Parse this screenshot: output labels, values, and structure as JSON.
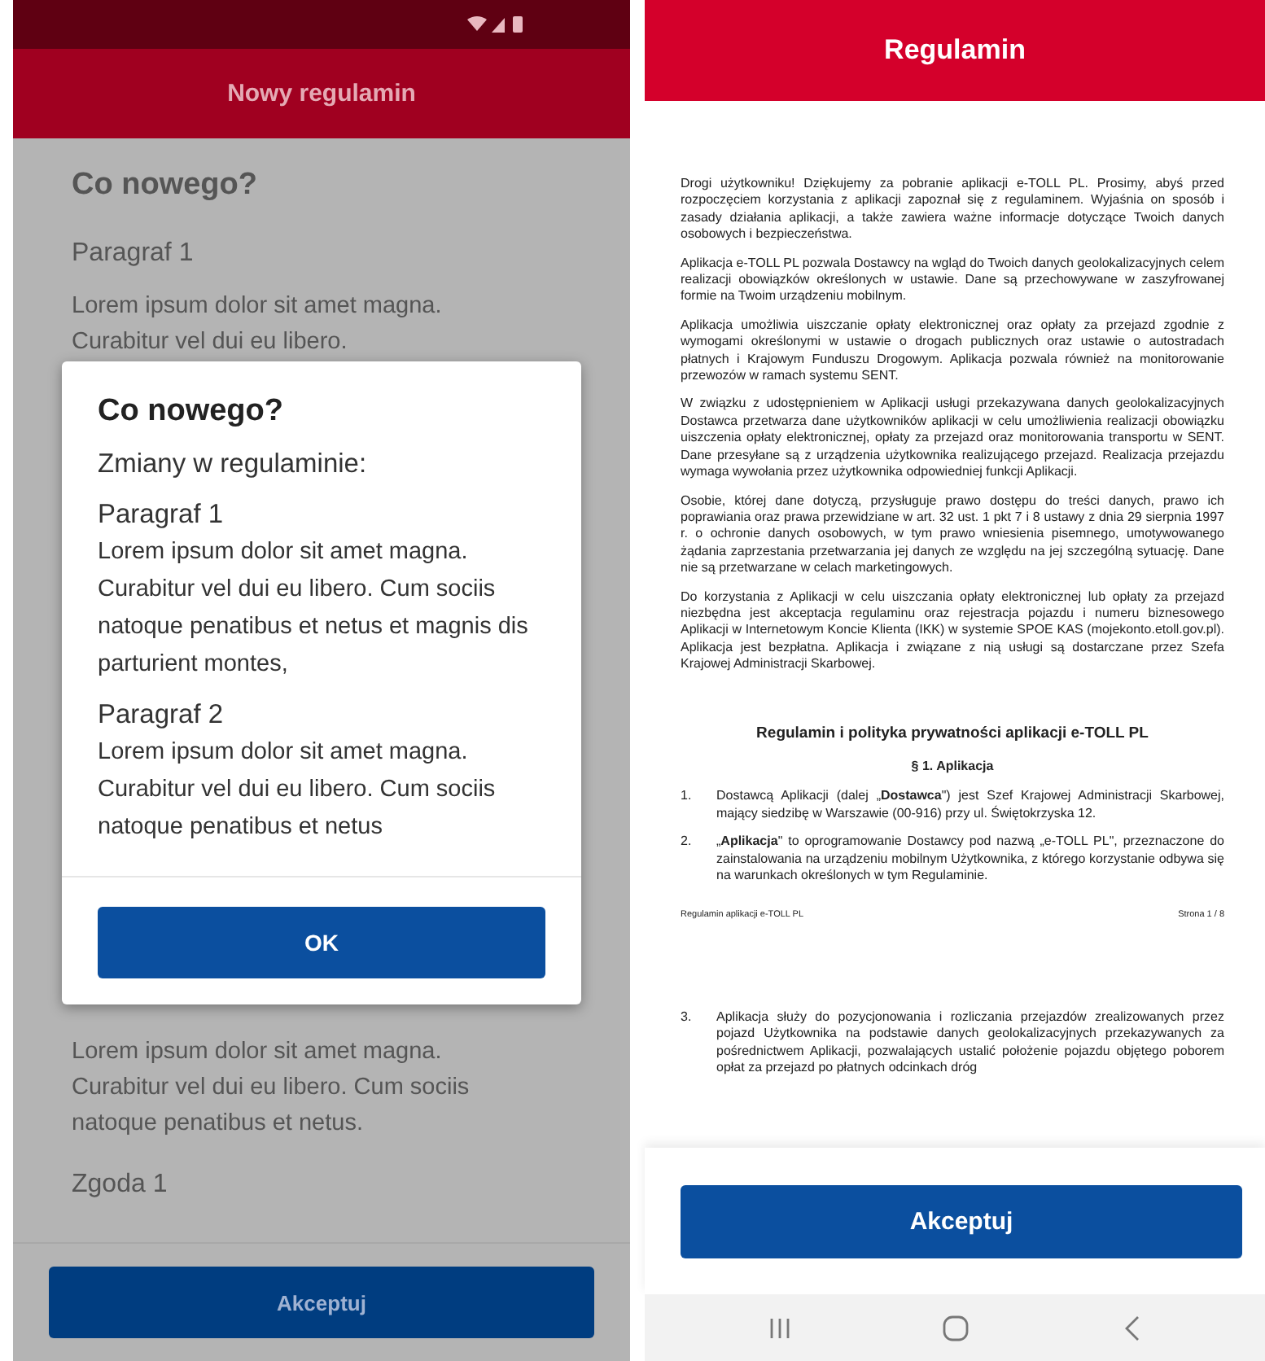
{
  "left_screen": {
    "header": {
      "title": "Nowy regulamin"
    },
    "background_top": [
      {
        "kind": "heading",
        "text": "Co nowego?"
      },
      {
        "kind": "subheading",
        "text": "Paragraf 1"
      },
      {
        "kind": "paragraph",
        "text": "Lorem ipsum dolor sit amet magna. Curabitur vel dui eu libero."
      }
    ],
    "background_bottom": [
      {
        "kind": "paragraph",
        "text": "Lorem ipsum dolor sit amet magna. Curabitur vel dui eu libero. Cum sociis natoque penatibus et netus."
      },
      {
        "kind": "subheading",
        "text": "Zgoda 1"
      }
    ],
    "bottom_button": "Akceptuj",
    "dialog": {
      "title": "Co nowego?",
      "subtitle": "Zmiany w regulaminie:",
      "sections": [
        {
          "heading": "Paragraf 1",
          "body": "Lorem ipsum dolor sit amet magna. Curabitur vel dui eu libero. Cum sociis natoque penatibus et netus et magnis dis parturient montes,"
        },
        {
          "heading": "Paragraf 2",
          "body": "Lorem ipsum dolor sit amet magna. Curabitur vel dui eu libero. Cum sociis natoque penatibus et netus"
        }
      ],
      "button": "OK"
    }
  },
  "right_screen": {
    "header": {
      "title": "Regulamin"
    },
    "document": {
      "paragraphs": [
        "Drogi użytkowniku! Dziękujemy za pobranie aplikacji e-TOLL PL. Prosimy, abyś przed rozpoczęciem korzystania z aplikacji zapoznał się z regulaminem. Wyjaśnia on sposób i zasady działania aplikacji, a także zawiera ważne informacje dotyczące Twoich danych osobowych i bezpieczeństwa.",
        "Aplikacja e-TOLL PL pozwala Dostawcy na wgląd do Twoich danych geolokalizacyjnych celem realizacji obowiązków określonych w ustawie. Dane są przechowywane w zaszyfrowanej formie na Twoim urządzeniu mobilnym.",
        "Aplikacja umożliwia uiszczanie opłaty elektronicznej oraz opłaty za przejazd zgodnie z wymogami określonymi w ustawie o drogach publicznych oraz ustawie o autostradach płatnych i Krajowym Funduszu Drogowym. Aplikacja pozwala również na monitorowanie przewozów w ramach systemu SENT.",
        "W związku z udostępnieniem w Aplikacji usługi przekazywana danych geolokalizacyjnych Dostawca przetwarza dane użytkowników aplikacji w celu umożliwienia realizacji obowiązku uiszczenia opłaty elektronicznej, opłaty za przejazd oraz monitorowania transportu w SENT. Dane przesyłane są z urządzenia użytkownika realizującego przejazd. Realizacja przejazdu wymaga wywołania przez użytkownika odpowiedniej funkcji Aplikacji.",
        "Osobie, której dane dotyczą, przysługuje prawo dostępu do treści danych, prawo ich poprawiania oraz prawa przewidziane w art. 32 ust. 1 pkt 7 i 8 ustawy z dnia 29 sierpnia 1997 r. o ochronie danych osobowych, w tym prawo wniesienia pisemnego, umotywowanego żądania zaprzestania przetwarzania jej danych ze względu na jej szczególną sytuację. Dane nie są przetwarzane w celach marketingowych.",
        "Do korzystania z Aplikacji w celu uiszczania opłaty elektronicznej lub opłaty za przejazd niezbędna jest akceptacja regulaminu oraz rejestracja pojazdu i numeru biznesowego Aplikacji w Internetowym Koncie Klienta (IKK) w systemie SPOE KAS (mojekonto.etoll.gov.pl). Aplikacja jest bezpłatna. Aplikacja i związane z nią usługi są dostarczane przez Szefa Krajowej Administracji Skarbowej."
      ],
      "title": "Regulamin i polityka prywatności aplikacji e-TOLL PL",
      "section_title": "§ 1. Aplikacja",
      "items": [
        {
          "number": "1.",
          "text": "Dostawcą Aplikacji (dalej „**Dostawca**\") jest Szef Krajowej Administracji Skarbowej, mający siedzibę w Warszawie (00-916) przy ul. Świętokrzyska 12."
        },
        {
          "number": "2.",
          "text": "„**Aplikacja**\" to oprogramowanie Dostawcy pod nazwą „e-TOLL PL\", przeznaczone do zainstalowania na urządzeniu mobilnym Użytkownika, z którego korzystanie odbywa się na warunkach określonych w tym Regulaminie."
        }
      ],
      "footer": {
        "left": "Regulamin aplikacji e-TOLL PL",
        "right": "Strona 1 / 8"
      },
      "next_page_items": [
        {
          "number": "3.",
          "text": "Aplikacja służy do pozycjonowania i rozliczania przejazdów zrealizowanych przez pojazd Użytkownika na podstawie danych geolokalizacyjnych przekazywanych za pośrednictwem Aplikacji, pozwalających ustalić położenie pojazdu objętego poborem opłat za przejazd po płatnych odcinkach dróg"
        }
      ]
    },
    "accept_button": "Akceptuj"
  }
}
